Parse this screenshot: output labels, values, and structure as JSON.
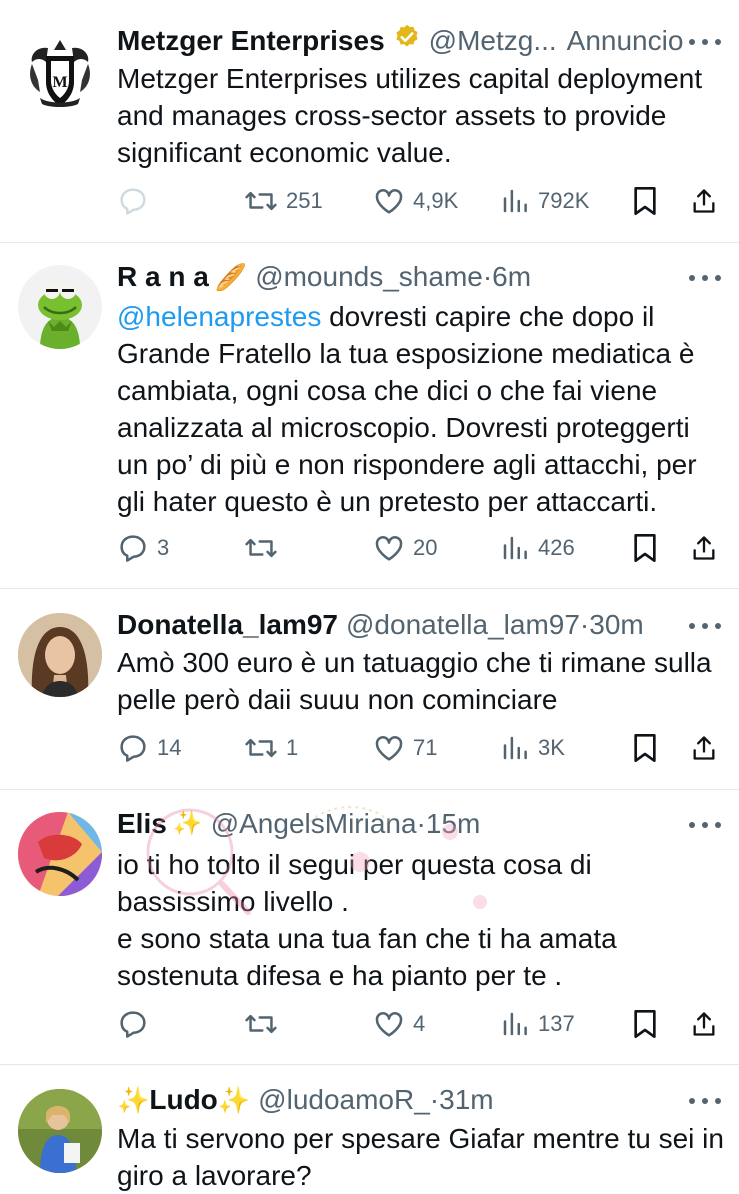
{
  "tweets": [
    {
      "name": "Metzger Enterprises",
      "handle": "@Metzg...",
      "ad_label": "Annuncio",
      "text": "Metzger Enterprises utilizes capital deployment and manages cross-sector assets to provide significant economic value.",
      "reply_count": "",
      "retweet_count": "251",
      "like_count": "4,9K",
      "view_count": "792K",
      "icons": [
        "seal-avatar",
        "verified-badge-icon"
      ]
    },
    {
      "name": "R a n a",
      "emoji": "🥖",
      "handle": "@mounds_shame",
      "separator": "·",
      "time": "6m",
      "mention": "@helenaprestes",
      "text": " dovresti capire che dopo il Grande Fratello la tua esposizione mediatica è cambiata, ogni cosa che dici o che fai viene analizzata al microscopio. Dovresti proteggerti un po’ di più e non rispondere agli attacchi, per gli hater questo è un pretesto per attaccarti.",
      "reply_count": "3",
      "retweet_count": "",
      "like_count": "20",
      "view_count": "426"
    },
    {
      "name": "Donatella_lam97",
      "handle": "@donatella_lam97",
      "separator": "·",
      "time": "30m",
      "text": "Amò 300 euro è un tatuaggio che ti rimane sulla pelle però daii suuu non cominciare",
      "reply_count": "14",
      "retweet_count": "1",
      "like_count": "71",
      "view_count": "3K"
    },
    {
      "name": "Elis",
      "emoji": "✨",
      "handle": "@AngelsMiriana",
      "separator": "·",
      "time": "15m",
      "text_lines": [
        "io ti ho tolto il segui per questa cosa di",
        "bassissimo livello .",
        "e sono stata una tua fan che ti ha amata",
        "sostenuta difesa e ha pianto per te ."
      ],
      "reply_count": "",
      "retweet_count": "",
      "like_count": "4",
      "view_count": "137"
    },
    {
      "name_prefix": "✨",
      "name": "Ludo",
      "name_suffix": "✨",
      "handle": "@ludoamoR_",
      "separator": "·",
      "time": "31m",
      "text": "Ma ti servono per spesare Giafar mentre tu sei in giro a lavorare?"
    }
  ],
  "colors": {
    "text": "#0f1419",
    "secondary": "#536471",
    "link": "#1d9bf0",
    "divider": "#e4e8ec",
    "verified_gold": "#e2b719"
  }
}
